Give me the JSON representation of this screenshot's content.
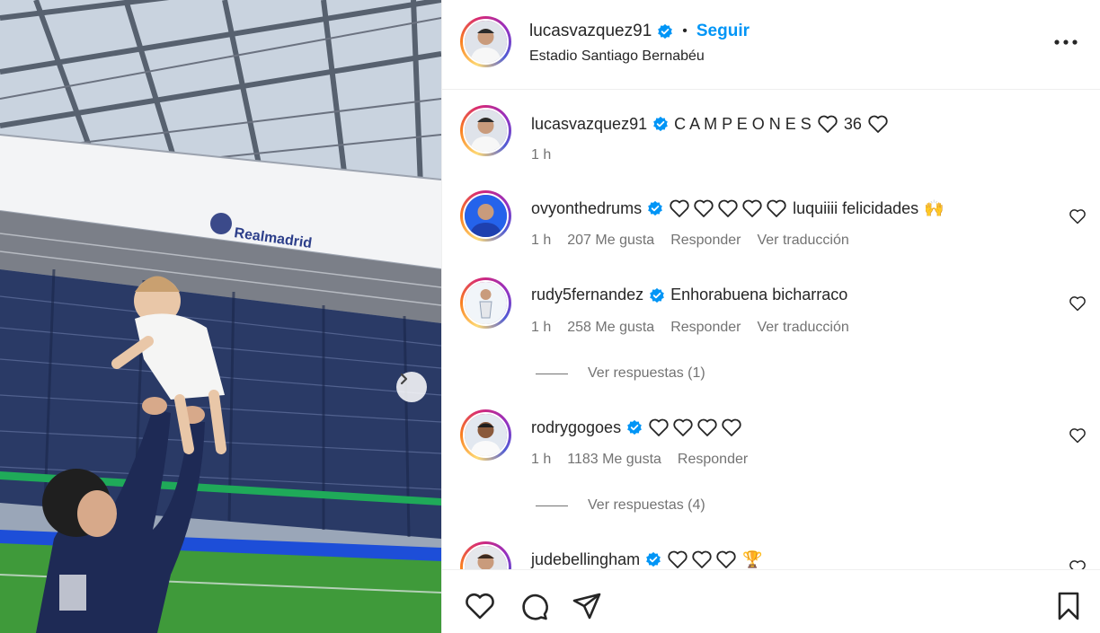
{
  "post": {
    "author": "lucasvazquez91",
    "separator": "•",
    "follow_label": "Seguir",
    "location": "Estadio Santiago Bernabéu",
    "photo_banner_text": "Realmadrid"
  },
  "caption": {
    "user": "lucasvazquez91",
    "text_a": "C A M P E O N E S",
    "text_b": "36",
    "time": "1 h"
  },
  "comments": [
    {
      "user": "ovyonthedrums",
      "hearts": 5,
      "text": "luquiiii felicidades",
      "emoji": "🙌",
      "time": "1 h",
      "likes": "207 Me gusta",
      "reply": "Responder",
      "translate": "Ver traducción"
    },
    {
      "user": "rudy5fernandez",
      "hearts": 0,
      "text": "Enhorabuena bicharraco",
      "time": "1 h",
      "likes": "258 Me gusta",
      "reply": "Responder",
      "translate": "Ver traducción",
      "view_replies": "Ver respuestas (1)"
    },
    {
      "user": "rodrygogoes",
      "hearts": 4,
      "text": "",
      "time": "1 h",
      "likes": "1183 Me gusta",
      "reply": "Responder",
      "view_replies": "Ver respuestas (4)"
    },
    {
      "user": "judebellingham",
      "hearts": 3,
      "text": "",
      "emoji": "🏆"
    }
  ],
  "icons": {
    "more": "more-horizontal-icon",
    "like": "heart-icon",
    "comment": "comment-icon",
    "share": "paper-plane-icon",
    "save": "bookmark-icon",
    "next": "chevron-right-icon",
    "verified": "verified-badge-icon"
  },
  "colors": {
    "link_blue": "#0095f6",
    "verified_blue": "#0095f6",
    "text": "#262626",
    "muted": "#737373"
  }
}
